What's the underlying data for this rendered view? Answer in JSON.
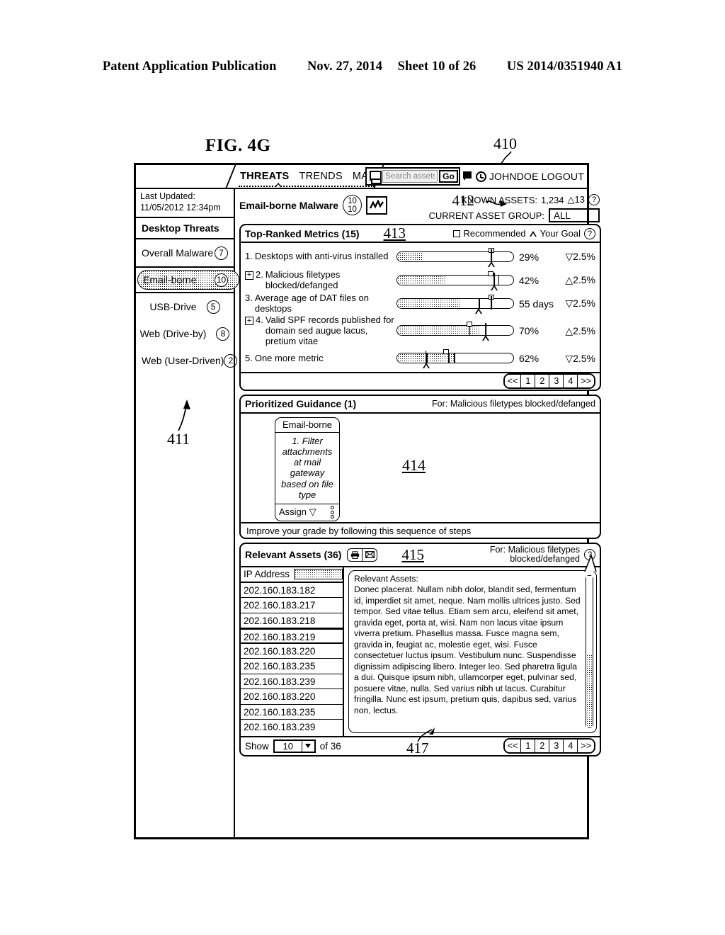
{
  "patent_header": {
    "left": "Patent Application Publication",
    "date": "Nov. 27, 2014",
    "sheet": "Sheet 10 of 26",
    "number": "US 2014/0351940 A1"
  },
  "figure": {
    "label": "FIG. 4G",
    "ref_410": "410",
    "ref_411": "411",
    "ref_412": "412",
    "ref_413": "413",
    "ref_414": "414",
    "ref_415": "415",
    "ref_417": "417"
  },
  "toolbar": {
    "tabs": [
      {
        "label": "THREATS",
        "active": true
      },
      {
        "label": "TRENDS",
        "active": false
      },
      {
        "label": "MANAGE",
        "active": false
      }
    ],
    "search_placeholder": "Search assets",
    "go_label": "Go",
    "user": "JOHNDOE",
    "logout": "LOGOUT"
  },
  "sidebar": {
    "last_updated_label": "Last Updated:",
    "last_updated_value": "11/05/2012 12:34pm",
    "title": "Desktop Threats",
    "items": [
      {
        "label": "Overall Malware",
        "badge": "7",
        "selected": false
      },
      {
        "label": "Email-borne",
        "badge": "10",
        "selected": true
      },
      {
        "label": "USB-Drive",
        "badge": "5",
        "selected": false
      },
      {
        "label": "Web (Drive-by)",
        "badge": "8",
        "selected": false
      },
      {
        "label": "Web (User-Driven)",
        "badge": "2",
        "selected": false
      }
    ]
  },
  "context": {
    "title": "Email-borne Malware",
    "score_top": "10",
    "score_bottom": "10",
    "known_assets_label": "KNOWN ASSETS:",
    "known_assets_value": "1,234",
    "known_assets_delta": "△13",
    "asset_group_label": "CURRENT ASSET GROUP:",
    "asset_group_value": "ALL"
  },
  "metrics_panel": {
    "title": "Top-Ranked Metrics (15)",
    "legend_recommended": "Recommended",
    "legend_goal": "Your Goal",
    "rows": [
      {
        "num": "1.",
        "expandable": false,
        "label": "Desktops with anti-virus installed",
        "value": "29%",
        "delta": "▽2.5%",
        "fill_pct": 22,
        "rec_pct": 81,
        "goal_pct": 81,
        "segments": []
      },
      {
        "num": "2.",
        "expandable": true,
        "label": "Malicious filetypes blocked/defanged",
        "value": "42%",
        "delta": "△2.5%",
        "fill_pct": 42,
        "rec_pct": 80,
        "goal_pct": 83,
        "segments": [
          87
        ]
      },
      {
        "num": "3.",
        "expandable": false,
        "label": "Average age of DAT files on desktops",
        "value": "55 days",
        "delta": "▽2.5%",
        "fill_pct": 55,
        "rec_pct": 81,
        "goal_pct": 70,
        "segments": [
          70
        ]
      },
      {
        "num": "4.",
        "expandable": true,
        "label": "Valid SPF records published for domain sed augue lacus, pretium vitae",
        "value": "70%",
        "delta": "△2.5%",
        "fill_pct": 72,
        "rec_pct": 62,
        "goal_pct": 76,
        "segments": [
          62,
          76
        ]
      },
      {
        "num": "5.",
        "expandable": false,
        "label": "One more metric",
        "value": "62%",
        "delta": "▽2.5%",
        "fill_pct": 49,
        "rec_pct": 42,
        "goal_pct": 25,
        "segments": [
          25,
          44,
          49
        ]
      }
    ],
    "pager": [
      "<<",
      "1",
      "2",
      "3",
      "4",
      ">>"
    ]
  },
  "guidance_panel": {
    "title": "Prioritized Guidance (1)",
    "for_text": "For: Malicious filetypes blocked/defanged",
    "card_header": "Email-borne",
    "card_body": "1. Filter attachments at mail gateway based on file type",
    "assign_label": "Assign",
    "footer": "Improve your grade by following this sequence of steps"
  },
  "assets_panel": {
    "title": "Relevant Assets (36)",
    "for_text_line1": "For: Malicious filetypes",
    "for_text_line2": "blocked/defanged",
    "column_header": "IP Address",
    "rows": [
      {
        "ip": "202.160.183.182",
        "selected": false
      },
      {
        "ip": "202.160.183.217",
        "selected": false
      },
      {
        "ip": "202.160.183.218",
        "selected": false
      },
      {
        "ip": "202.160.183.219",
        "selected": true
      },
      {
        "ip": "202.160.183.220",
        "selected": false
      },
      {
        "ip": "202.160.183.235",
        "selected": false
      },
      {
        "ip": "202.160.183.239",
        "selected": false
      },
      {
        "ip": "202.160.183.220",
        "selected": false
      },
      {
        "ip": "202.160.183.235",
        "selected": false
      },
      {
        "ip": "202.160.183.239",
        "selected": false
      }
    ],
    "detail_title": "Relevant Assets:",
    "detail_body": "Donec placerat. Nullam nibh dolor, blandit sed, fermentum id, imperdiet sit amet, neque. Nam mollis ultrices justo. Sed tempor. Sed vitae tellus. Etiam sem arcu, eleifend sit amet, gravida eget, porta at, wisi. Nam non lacus vitae ipsum viverra pretium. Phasellus massa. Fusce magna sem, gravida in, feugiat ac, molestie eget, wisi. Fusce consectetuer luctus ipsum. Vestibulum nunc. Suspendisse dignissim adipiscing libero. Integer leo. Sed pharetra ligula a dui. Quisque ipsum nibh, ullamcorper eget, pulvinar sed, posuere vitae, nulla. Sed varius nibh ut lacus. Curabitur fringilla. Nunc est ipsum, pretium quis, dapibus sed, varius non, lectus.",
    "show_label": "Show",
    "show_value": "10",
    "of_label": "of 36",
    "pager": [
      "<<",
      "1",
      "2",
      "3",
      "4",
      ">>"
    ]
  }
}
